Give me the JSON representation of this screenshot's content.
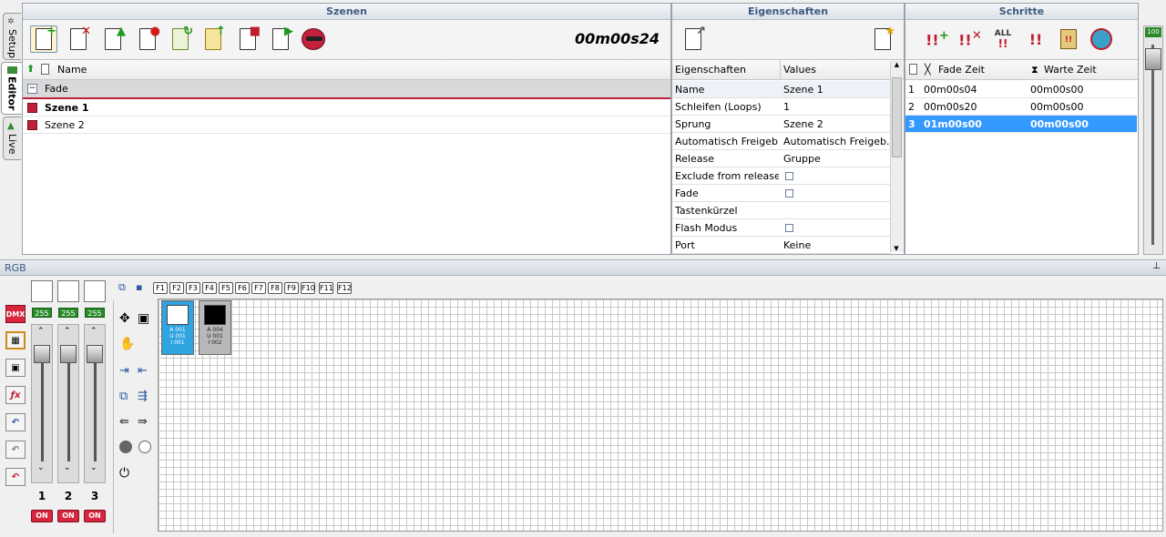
{
  "vtabs": [
    {
      "label": "Setup"
    },
    {
      "label": "Editor"
    },
    {
      "label": "Live"
    }
  ],
  "scenes": {
    "title": "Szenen",
    "time": "00m00s24",
    "name_header": "Name",
    "group": "Fade",
    "items": [
      {
        "label": "Szene 1",
        "selected": true
      },
      {
        "label": "Szene 2",
        "selected": false
      }
    ]
  },
  "properties": {
    "title": "Eigenschaften",
    "col1": "Eigenschaften",
    "col2": "Values",
    "rows": [
      {
        "key": "Name",
        "value": "Szene 1"
      },
      {
        "key": "Schleifen (Loops)",
        "value": "1"
      },
      {
        "key": "Sprung",
        "value": "Szene 2"
      },
      {
        "key": "Automatisch Freigeb...",
        "value": "Automatisch Freigeb..."
      },
      {
        "key": "Release",
        "value": "Gruppe"
      },
      {
        "key": "Exclude from release",
        "value": ""
      },
      {
        "key": "Fade",
        "value": ""
      },
      {
        "key": "Tastenkürzel",
        "value": ""
      },
      {
        "key": "Flash Modus",
        "value": ""
      },
      {
        "key": "Port",
        "value": "Keine"
      }
    ]
  },
  "steps": {
    "title": "Schritte",
    "col_fade": "Fade Zeit",
    "col_wait": "Warte Zeit",
    "all_label": "ALL",
    "rows": [
      {
        "n": "1",
        "fade": "00m00s04",
        "wait": "00m00s00"
      },
      {
        "n": "2",
        "fade": "00m00s20",
        "wait": "00m00s00"
      },
      {
        "n": "3",
        "fade": "01m00s00",
        "wait": "00m00s00"
      }
    ]
  },
  "master": {
    "value": "100"
  },
  "bottom": {
    "title": "RGB",
    "dmx_label": "DMX",
    "faders": [
      {
        "num": "1",
        "value": "255",
        "on": "ON"
      },
      {
        "num": "2",
        "value": "255",
        "on": "ON"
      },
      {
        "num": "3",
        "value": "255",
        "on": "ON"
      }
    ],
    "fkeys": [
      "F1",
      "F2",
      "F3",
      "F4",
      "F5",
      "F6",
      "F7",
      "F8",
      "F9",
      "F10",
      "F11",
      "F12"
    ],
    "devices": [
      {
        "l1": "A 001",
        "l2": "U 001",
        "l3": "I 001",
        "color": "#ffffff",
        "bg": "#2fa4e0"
      },
      {
        "l1": "A 004",
        "l2": "U 001",
        "l3": "I 002",
        "color": "#000000",
        "bg": "#b8b8b8"
      }
    ]
  }
}
